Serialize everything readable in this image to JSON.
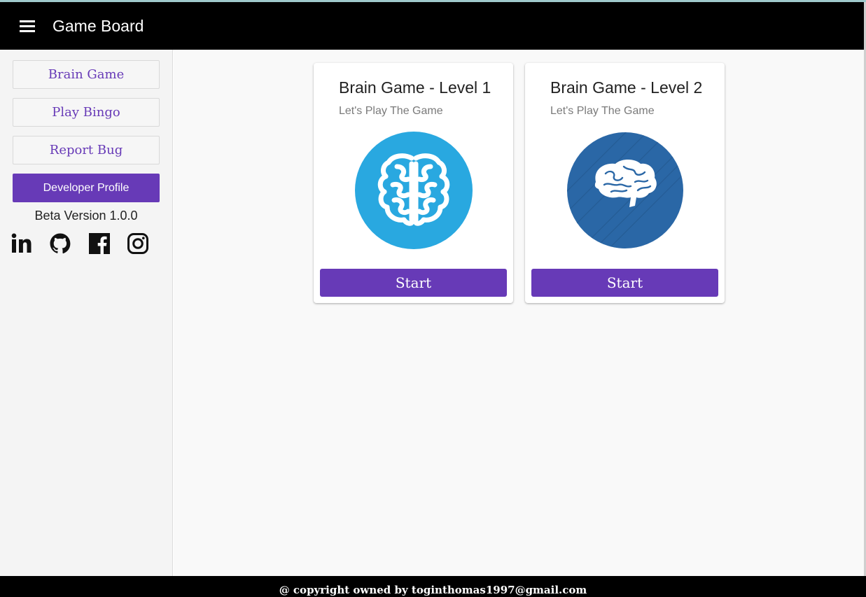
{
  "header": {
    "menu_icon": "hamburger-menu-icon",
    "title": "Game Board"
  },
  "sidebar": {
    "items": [
      {
        "label": "Brain Game"
      },
      {
        "label": "Play Bingo"
      },
      {
        "label": "Report Bug"
      }
    ],
    "developer_button": "Developer Profile",
    "version": "Beta Version 1.0.0",
    "social_icons": [
      "linkedin-icon",
      "github-icon",
      "facebook-icon",
      "instagram-icon"
    ]
  },
  "cards": [
    {
      "title": "Brain Game - Level 1",
      "subtitle": "Let's Play The Game",
      "image_icon": "brain-top-view-icon",
      "button": "Start",
      "circle_color": "#29a8e0"
    },
    {
      "title": "Brain Game - Level 2",
      "subtitle": "Let's Play The Game",
      "image_icon": "brain-side-view-icon",
      "button": "Start",
      "circle_color": "#2a67a6"
    }
  ],
  "footer": {
    "text": "@ copyright owned by toginthomas1997@gmail.com"
  },
  "colors": {
    "accent": "#673ab7",
    "topbar": "#000000",
    "footer": "#000000"
  }
}
